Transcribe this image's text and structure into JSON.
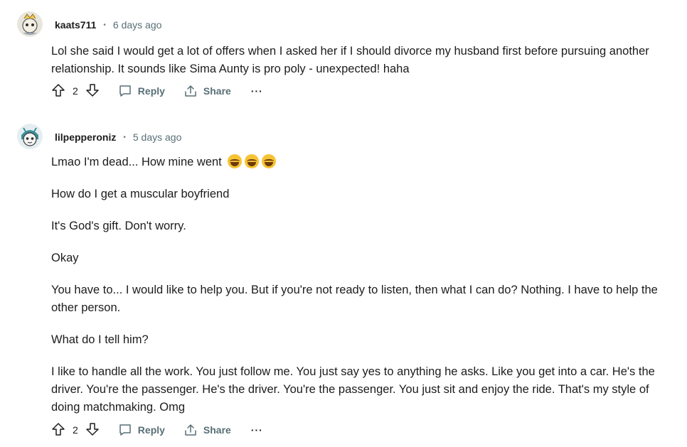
{
  "comments": [
    {
      "username": "kaats711",
      "separator": "•",
      "time": "6 days ago",
      "avatar": "snoo-avatar-yellow",
      "paragraphs": [
        "Lol she said I would get a lot of offers when I asked her if I should divorce my husband first before pursuing another relationship. It sounds like Sima Aunty is pro poly - unexpected! haha"
      ],
      "score": "2",
      "reply_label": "Reply",
      "share_label": "Share",
      "more_label": "···"
    },
    {
      "username": "lilpepperoniz",
      "separator": "•",
      "time": "5 days ago",
      "avatar": "snoo-avatar-teal",
      "first_line": "Lmao I'm dead... How mine went",
      "emoji_icons": [
        "face-with-tears-of-joy-icon",
        "face-with-tears-of-joy-icon",
        "face-with-tears-of-joy-icon"
      ],
      "paragraphs": [
        "How do I get a muscular boyfriend",
        "It's God's gift. Don't worry.",
        "Okay",
        "You have to... I would like to help you. But if you're not ready to listen, then what I can do? Nothing. I have to help the other person.",
        "What do I tell him?",
        "I like to handle all the work. You just follow me. You just say yes to anything he asks. Like you get into a car. He's the driver. You're the passenger. He's the driver. You're the passenger. You just sit and enjoy the ride. That's my style of doing matchmaking. Omg"
      ],
      "score": "2",
      "reply_label": "Reply",
      "share_label": "Share",
      "more_label": "···"
    }
  ],
  "colors": {
    "text": "#1c1c1c",
    "meta": "#576f76",
    "emoji": "#f7c335"
  }
}
